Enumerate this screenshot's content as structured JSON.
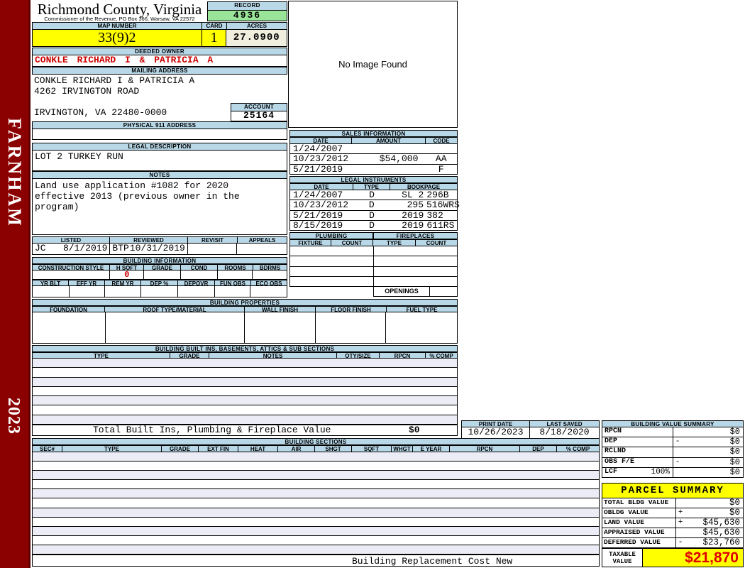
{
  "colors": {
    "sidebar_red": "#8B0000",
    "accent_red": "#CC0000",
    "taxable_red": "#E00000",
    "header_blue": "#B8D8E8",
    "record_green": "#9AE49A",
    "highlight_yellow": "#FFFF00",
    "acres_beige": "#EFEEDF",
    "stripe_lavender": "#ECECF6"
  },
  "sidebar": {
    "district": "FARNHAM",
    "year": "2023"
  },
  "header": {
    "county": "Richmond County, Virginia",
    "commissioner": "Commissioner of the Revenue, PO Box 366, Warsaw, VA 22572",
    "record_label": "RECORD",
    "record_value": "4936",
    "map_number_label": "MAP NUMBER",
    "map_number": "33(9)2",
    "card_label": "CARD",
    "card_value": "1",
    "acres_label": "ACRES",
    "acres_value": "27.0900"
  },
  "owner": {
    "deeded_label": "DEEDED OWNER",
    "name": "CONKLE RICHARD I & PATRICIA A",
    "mailing_label": "MAILING ADDRESS",
    "address_line1": "CONKLE RICHARD I & PATRICIA A",
    "address_line2": "4262 IRVINGTON ROAD",
    "address_line3": "IRVINGTON, VA 22480-0000",
    "account_label": "ACCOUNT",
    "account_value": "25164",
    "physical_label": "PHYSICAL 911 ADDRESS",
    "physical_value": ""
  },
  "legal": {
    "label": "LEGAL DESCRIPTION",
    "text": "LOT 2 TURKEY RUN"
  },
  "notes": {
    "label": "NOTES",
    "line1": "Land use application #1082 for 2020",
    "line2": "effective 2013 (previous owner in the",
    "line3": "program)"
  },
  "review": {
    "listed_label": "LISTED",
    "reviewed_label": "REVIEWED",
    "revisit_label": "REVISIT",
    "appeals_label": "APPEALS",
    "listed_by": "JC",
    "listed_date": "8/1/2019",
    "reviewed_by": "BTP",
    "reviewed_date": "10/31/2019",
    "revisit_value": "",
    "appeals_value": ""
  },
  "building_info": {
    "label": "BUILDING INFORMATION",
    "cols_row1": [
      "CONSTRUCTION STYLE",
      "H SQFT",
      "GRADE",
      "COND",
      "ROOMS",
      "BDRMS"
    ],
    "h_sqft_value": "0",
    "cols_row2": [
      "YR BLT",
      "EFF YR",
      "REM YR",
      "DEP %",
      "DEPOVR",
      "FUN OBS",
      "ECO OBS"
    ]
  },
  "building_properties": {
    "label": "BUILDING PROPERTIES",
    "cols": [
      "FOUNDATION",
      "ROOF TYPE/MATERIAL",
      "WALL FINISH",
      "FLOOR FINISH",
      "FUEL TYPE"
    ]
  },
  "built_ins": {
    "label": "BUILDING BUILT INS, BASEMENTS, ATTICS & SUB SECTIONS",
    "cols": [
      "TYPE",
      "GRADE",
      "NOTES",
      "QTY/SIZE",
      "RPCN",
      "% COMP"
    ],
    "total_label": "Total Built Ins, Plumbing & Fireplace Value",
    "total_value": "$0"
  },
  "image_box": {
    "text": "No Image Found"
  },
  "sales": {
    "label": "SALES INFORMATION",
    "cols": [
      "DATE",
      "AMOUNT",
      "CODE"
    ],
    "rows": [
      {
        "date": "1/24/2007",
        "amount": "",
        "code": ""
      },
      {
        "date": "10/23/2012",
        "amount": "$54,000",
        "code": "AA"
      },
      {
        "date": "5/21/2019",
        "amount": "",
        "code": "F"
      }
    ]
  },
  "instruments": {
    "label": "LEGAL INSTRUMENTS",
    "cols": [
      "DATE",
      "TYPE",
      "BOOKPAGE"
    ],
    "rows": [
      {
        "date": "1/24/2007",
        "type": "D",
        "book": "SL 2",
        "page": "296B"
      },
      {
        "date": "10/23/2012",
        "type": "D",
        "book": "295",
        "page": "516WRS"
      },
      {
        "date": "5/21/2019",
        "type": "D",
        "book": "2019",
        "page": "382"
      },
      {
        "date": "8/15/2019",
        "type": "D",
        "book": "2019",
        "page": "611RS"
      }
    ]
  },
  "plumbing": {
    "label": "PLUMBING",
    "cols": [
      "FIXTURE",
      "COUNT"
    ]
  },
  "fireplaces": {
    "label": "FIREPLACES",
    "cols": [
      "TYPE",
      "COUNT"
    ],
    "openings_label": "OPENINGS",
    "openings_value": ""
  },
  "print_info": {
    "print_date_label": "PRINT DATE",
    "print_date": "10/26/2023",
    "last_saved_label": "LAST SAVED",
    "last_saved": "8/18/2020"
  },
  "building_value_summary": {
    "label": "BUILDING VALUE SUMMARY",
    "rows": [
      {
        "label": "RPCN",
        "op": "",
        "value": "$0"
      },
      {
        "label": "DEP",
        "op": "-",
        "value": "$0"
      },
      {
        "label": "RCLND",
        "op": "",
        "value": "$0"
      },
      {
        "label": "OBS F/E",
        "op": "-",
        "value": "$0"
      },
      {
        "label": "LCF",
        "pct": "100%",
        "op": "",
        "value": "$0"
      }
    ]
  },
  "building_sections": {
    "label": "BUILDING SECTIONS",
    "cols": [
      "SEC#",
      "TYPE",
      "GRADE",
      "EXT FIN",
      "HEAT",
      "AIR",
      "SHGT",
      "SQFT",
      "WHGT",
      "E YEAR",
      "RPCN",
      "DEP",
      "% COMP"
    ],
    "footer": "Building Replacement Cost New"
  },
  "parcel_summary": {
    "label": "PARCEL SUMMARY",
    "rows": [
      {
        "label": "TOTAL BLDG VALUE",
        "op": "",
        "value": "$0"
      },
      {
        "label": "OBLDG VALUE",
        "op": "+",
        "value": "$0"
      },
      {
        "label": "LAND VALUE",
        "op": "+",
        "value": "$45,630"
      },
      {
        "label": "APPRAISED VALUE",
        "op": "",
        "value": "$45,630"
      },
      {
        "label": "DEFERRED VALUE",
        "op": "-",
        "value": "$23,760"
      }
    ],
    "taxable_label": "TAXABLE VALUE",
    "taxable_value": "$21,870"
  }
}
